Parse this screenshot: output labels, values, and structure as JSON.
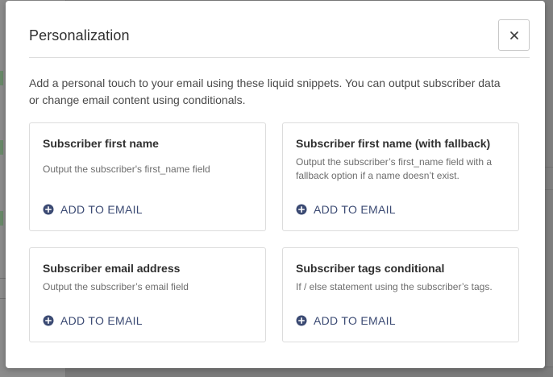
{
  "modal": {
    "title": "Personalization",
    "close_icon": "close-icon",
    "description": "Add a personal touch to your email using these liquid snippets. You can output subscriber data or change email content using conditionals."
  },
  "snippets": [
    {
      "title": "Subscriber first name",
      "description": "Output the subscriber's first_name field",
      "action": "ADD TO EMAIL",
      "icon": "plus-circle-icon"
    },
    {
      "title": "Subscriber first name (with fallback)",
      "description": "Output the subscriber’s first_name field with a fallback option if a name doesn’t exist.",
      "action": "ADD TO EMAIL",
      "icon": "plus-circle-icon"
    },
    {
      "title": "Subscriber email address",
      "description": "Output the subscriber’s email field",
      "action": "ADD TO EMAIL",
      "icon": "plus-circle-icon"
    },
    {
      "title": "Subscriber tags conditional",
      "description": "If / else statement using the subscriber’s tags.",
      "action": "ADD TO EMAIL",
      "icon": "plus-circle-icon"
    }
  ],
  "colors": {
    "accent": "#3b4a73",
    "overlay": "#8a8a8a",
    "card_border": "#dcdcdc"
  }
}
